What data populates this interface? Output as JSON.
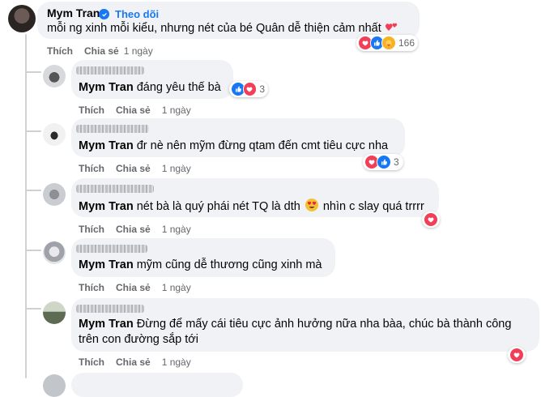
{
  "main_comment": {
    "author": "Mym Tran",
    "follow_label": "Theo dõi",
    "text": "mỗi ng xinh mỗi kiểu, nhưng nét của bé Quân dễ thiện cảm nhất",
    "emoji": "two-hearts",
    "reaction_count": "166",
    "reaction_icons": [
      "love-icon",
      "like-icon",
      "care-icon"
    ],
    "actions": {
      "like": "Thích",
      "share": "Chia sẻ",
      "time": "1 ngày"
    }
  },
  "replies": [
    {
      "tag": "Mym Tran",
      "text": "đáng yêu thế bà",
      "reaction_count": "3",
      "reaction_icons": [
        "like-icon",
        "love-icon"
      ],
      "actions": {
        "like": "Thích",
        "share": "Chia sẻ",
        "time": "1 ngày"
      }
    },
    {
      "tag": "Mym Tran",
      "text": "đr nè nên mỹm đừng qtam đến cmt tiêu cực nha",
      "reaction_count": "3",
      "reaction_icons": [
        "love-icon",
        "like-icon"
      ],
      "actions": {
        "like": "Thích",
        "share": "Chia sẻ",
        "time": "1 ngày"
      }
    },
    {
      "tag": "Mym Tran",
      "text_before": "nét bà là quý phái nét TQ là dth",
      "text_after": "nhìn c slay quá trrrr",
      "emoji": "heart-eyes",
      "reaction_icons": [
        "love-icon"
      ],
      "actions": {
        "like": "Thích",
        "share": "Chia sẻ",
        "time": "1 ngày"
      }
    },
    {
      "tag": "Mym Tran",
      "text": "mỹm cũng dễ thương cũng xinh mà",
      "actions": {
        "like": "Thích",
        "share": "Chia sẻ",
        "time": "1 ngày"
      }
    },
    {
      "tag": "Mym Tran",
      "text_line1": "Đừng để mấy cái tiêu cực ảnh hưởng nữa nha bàa, chúc bà thành công",
      "text_line2": "trên con đường sắp tới",
      "reaction_icons": [
        "love-icon"
      ],
      "actions": {
        "like": "Thích",
        "share": "Chia sẻ",
        "time": "1 ngày"
      }
    }
  ],
  "colors": {
    "like": "#1877f2",
    "love": "#f33e58",
    "care": "#f7b125",
    "bubble": "#f0f2f5",
    "meta": "#65676b"
  }
}
